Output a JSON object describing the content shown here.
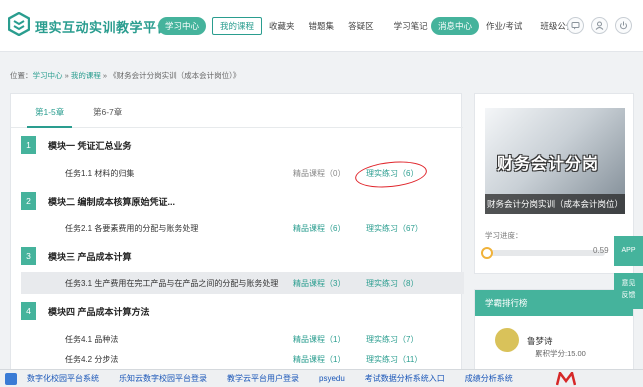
{
  "header": {
    "app_title": "理实互动实训教学平台",
    "nav_pill": "学习中心",
    "nav_items": [
      "我的课程",
      "收藏夹",
      "错题集",
      "答疑区",
      "学习笔记"
    ],
    "nav2_pill": "消息中心",
    "nav2_items": [
      "作业/考试",
      "班级公告"
    ],
    "accent": "#45b39c"
  },
  "breadcrumb": {
    "prefix": "位置：",
    "part1": "学习中心",
    "sep1": " » ",
    "part2": "我的课程",
    "sep2": " » ",
    "part3": "《财务会计分岗实训（成本会计岗位）》"
  },
  "tabs": [
    "第1-5章",
    "第6-7章"
  ],
  "modules": [
    {
      "num": "1",
      "title": "模块一 凭证汇总业务",
      "tasks": [
        {
          "title": "任务1.1 材料的归集",
          "lecture": "精品课程（0）",
          "exercise": "理实练习（6）"
        }
      ]
    },
    {
      "num": "2",
      "title": "模块二 编制成本核算原始凭证...",
      "tasks": [
        {
          "title": "任务2.1 各要素费用的分配与账务处理",
          "lecture": "精品课程（6）",
          "exercise": "理实练习（67）"
        }
      ]
    },
    {
      "num": "3",
      "title": "模块三 产品成本计算",
      "tasks": [
        {
          "title": "任务3.1 生产费用在完工产品与在产品之间的分配与账务处理",
          "lecture": "精品课程（3）",
          "exercise": "理实练习（8）"
        }
      ]
    },
    {
      "num": "4",
      "title": "模块四 产品成本计算方法",
      "tasks": [
        {
          "title": "任务4.1 品种法",
          "lecture": "精品课程（1）",
          "exercise": "理实练习（7）"
        },
        {
          "title": "任务4.2 分步法",
          "lecture": "精品课程（1）",
          "exercise": "理实练习（11）"
        }
      ]
    }
  ],
  "course": {
    "cover_title": "财务会计分岗",
    "cover_subtitle": "财务会计分岗实训（成本会计岗位）",
    "progress_label": "学习进度：",
    "progress_value_text": "0.59",
    "progress_fraction": 0.0059
  },
  "ranking": {
    "header": "学霸排行榜",
    "name": "鲁梦诗",
    "score": "累积学分:15.00"
  },
  "side_buttons": [
    "APP",
    "意见\n反馈"
  ],
  "bookmarks": [
    "数字化校园平台系统",
    "乐知云数字校园平台登录",
    "教学云平台用户登录",
    "psyedu",
    "考试数据分析系统入口",
    "成绩分析系统"
  ]
}
